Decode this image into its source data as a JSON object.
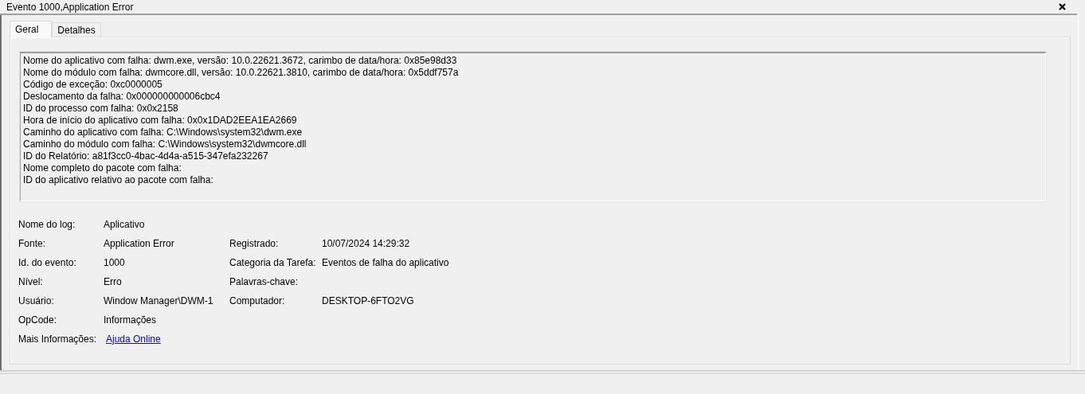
{
  "window": {
    "title": "Evento 1000,Application Error"
  },
  "tabs": [
    {
      "label": "Geral",
      "selected": true
    },
    {
      "label": "Detalhes",
      "selected": false
    }
  ],
  "description": [
    "Nome do aplicativo com falha: dwm.exe, versão: 10.0.22621.3672, carimbo de data/hora: 0x85e98d33",
    "Nome do módulo com falha: dwmcore.dll, versão: 10.0.22621.3810, carimbo de data/hora: 0x5ddf757a",
    "Código de exceção: 0xc0000005",
    "Deslocamento da falha: 0x000000000006cbc4",
    "ID do processo com falha: 0x0x2158",
    "Hora de início do aplicativo com falha: 0x0x1DAD2EEA1EA2669",
    "Caminho do aplicativo com falha: C:\\Windows\\system32\\dwm.exe",
    "Caminho do módulo com falha: C:\\Windows\\system32\\dwmcore.dll",
    "ID do Relatório: a81f3cc0-4bac-4d4a-a515-347efa232267",
    "Nome completo do pacote com falha:",
    "ID do aplicativo relativo ao pacote com falha:"
  ],
  "details": [
    {
      "left": {
        "label": "Nome do log:",
        "value": "Aplicativo",
        "kind": "text"
      }
    },
    {
      "left": {
        "label": "Fonte:",
        "value": "Application Error",
        "kind": "text"
      },
      "right": {
        "label": "Registrado:",
        "value": "10/07/2024 14:29:32",
        "kind": "text"
      }
    },
    {
      "left": {
        "label": "Id. do evento:",
        "value": "1000",
        "kind": "text"
      },
      "right": {
        "label": "Categoria da Tarefa:",
        "value": "Eventos de falha do aplicativo",
        "kind": "text"
      }
    },
    {
      "left": {
        "label": "Nível:",
        "value": "Erro",
        "kind": "text"
      },
      "right": {
        "label": "Palavras-chave:"
      }
    },
    {
      "left": {
        "label": "Usuário:",
        "value": "Window Manager\\DWM-1",
        "kind": "text"
      },
      "right": {
        "label": "Computador:",
        "value": "DESKTOP-6FTO2VG",
        "kind": "text"
      }
    },
    {
      "left": {
        "label": "OpCode:",
        "value": "Informações",
        "kind": "text"
      }
    },
    {
      "left": {
        "label": "Mais Informações:",
        "value": "Ajuda Online",
        "kind": "link"
      }
    }
  ]
}
